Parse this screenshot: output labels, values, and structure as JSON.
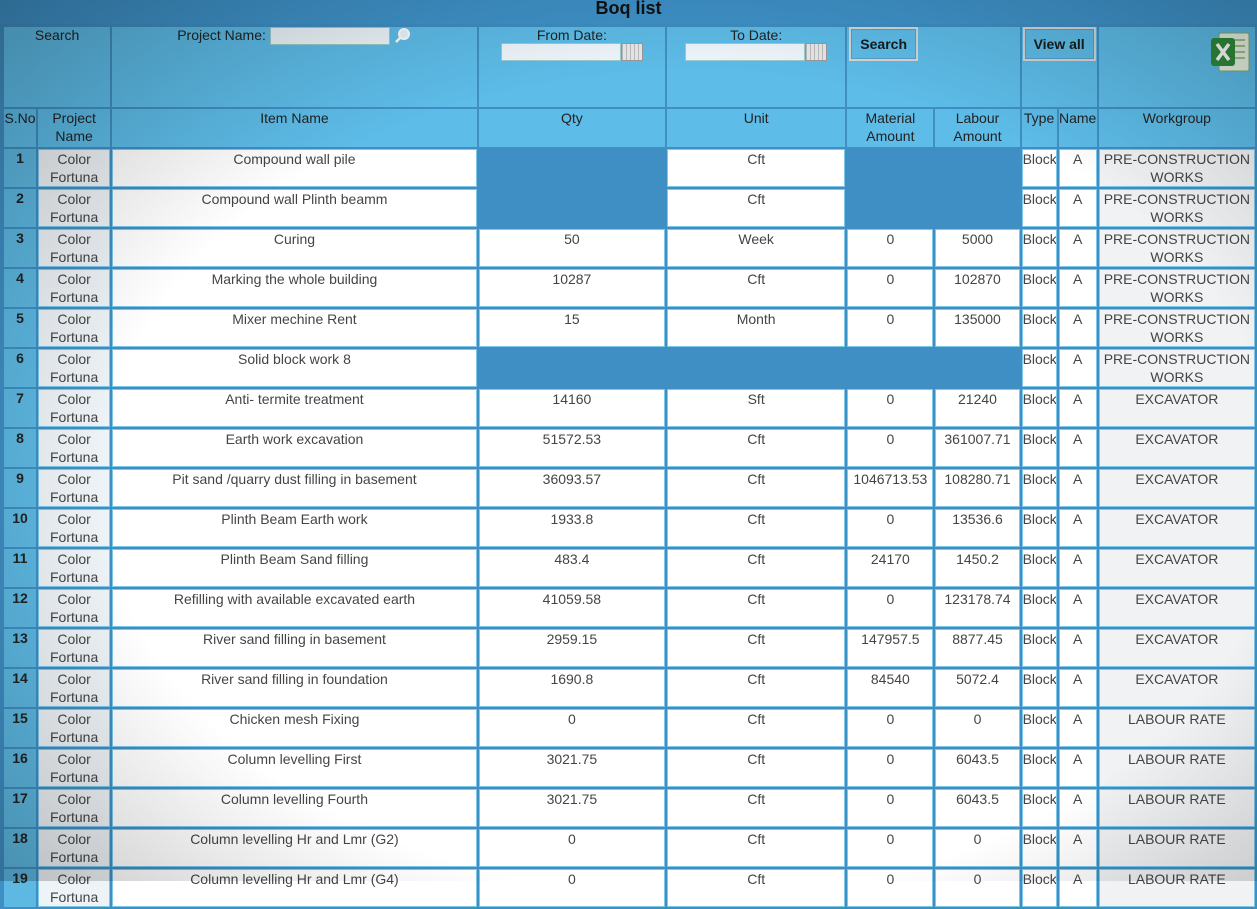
{
  "title": "Boq list",
  "filters": {
    "search_label": "Search",
    "project_name_label": "Project Name:",
    "project_name_value": "",
    "from_date_label": "From Date:",
    "from_date_value": "",
    "to_date_label": "To Date:",
    "to_date_value": "",
    "search_button": "Search",
    "view_all_button": "View all"
  },
  "columns": {
    "sno": "S.No",
    "project": "Project Name",
    "item": "Item Name",
    "qty": "Qty",
    "unit": "Unit",
    "material": "Material Amount",
    "labour": "Labour Amount",
    "type": "Type",
    "name": "Name",
    "workgroup": "Workgroup"
  },
  "rows": [
    {
      "sno": "1",
      "project": "Color Fortuna",
      "item": "Compound wall pile",
      "qty": "",
      "unit": "Cft",
      "material": "",
      "labour": "",
      "type": "Block",
      "name": "A",
      "workgroup": "PRE-CONSTRUCTION WORKS"
    },
    {
      "sno": "2",
      "project": "Color Fortuna",
      "item": "Compound wall Plinth beamm",
      "qty": "",
      "unit": "Cft",
      "material": "",
      "labour": "",
      "type": "Block",
      "name": "A",
      "workgroup": "PRE-CONSTRUCTION WORKS"
    },
    {
      "sno": "3",
      "project": "Color Fortuna",
      "item": "Curing",
      "qty": "50",
      "unit": "Week",
      "material": "0",
      "labour": "5000",
      "type": "Block",
      "name": "A",
      "workgroup": "PRE-CONSTRUCTION WORKS"
    },
    {
      "sno": "4",
      "project": "Color Fortuna",
      "item": "Marking the whole building",
      "qty": "10287",
      "unit": "Cft",
      "material": "0",
      "labour": "102870",
      "type": "Block",
      "name": "A",
      "workgroup": "PRE-CONSTRUCTION WORKS"
    },
    {
      "sno": "5",
      "project": "Color Fortuna",
      "item": "Mixer mechine Rent",
      "qty": "15",
      "unit": "Month",
      "material": "0",
      "labour": "135000",
      "type": "Block",
      "name": "A",
      "workgroup": "PRE-CONSTRUCTION WORKS"
    },
    {
      "sno": "6",
      "project": "Color Fortuna",
      "item": "Solid block work 8",
      "qty": "",
      "unit": "",
      "material": "",
      "labour": "",
      "type": "Block",
      "name": "A",
      "workgroup": "PRE-CONSTRUCTION WORKS"
    },
    {
      "sno": "7",
      "project": "Color Fortuna",
      "item": "Anti- termite treatment",
      "qty": "14160",
      "unit": "Sft",
      "material": "0",
      "labour": "21240",
      "type": "Block",
      "name": "A",
      "workgroup": "EXCAVATOR"
    },
    {
      "sno": "8",
      "project": "Color Fortuna",
      "item": "Earth work excavation",
      "qty": "51572.53",
      "unit": "Cft",
      "material": "0",
      "labour": "361007.71",
      "type": "Block",
      "name": "A",
      "workgroup": "EXCAVATOR"
    },
    {
      "sno": "9",
      "project": "Color Fortuna",
      "item": "Pit sand /quarry dust filling in basement",
      "qty": "36093.57",
      "unit": "Cft",
      "material": "1046713.53",
      "labour": "108280.71",
      "type": "Block",
      "name": "A",
      "workgroup": "EXCAVATOR"
    },
    {
      "sno": "10",
      "project": "Color Fortuna",
      "item": "Plinth Beam Earth work",
      "qty": "1933.8",
      "unit": "Cft",
      "material": "0",
      "labour": "13536.6",
      "type": "Block",
      "name": "A",
      "workgroup": "EXCAVATOR"
    },
    {
      "sno": "11",
      "project": "Color Fortuna",
      "item": "Plinth Beam Sand filling",
      "qty": "483.4",
      "unit": "Cft",
      "material": "24170",
      "labour": "1450.2",
      "type": "Block",
      "name": "A",
      "workgroup": "EXCAVATOR"
    },
    {
      "sno": "12",
      "project": "Color Fortuna",
      "item": "Refilling with available excavated earth",
      "qty": "41059.58",
      "unit": "Cft",
      "material": "0",
      "labour": "123178.74",
      "type": "Block",
      "name": "A",
      "workgroup": "EXCAVATOR"
    },
    {
      "sno": "13",
      "project": "Color Fortuna",
      "item": "River sand filling in basement",
      "qty": "2959.15",
      "unit": "Cft",
      "material": "147957.5",
      "labour": "8877.45",
      "type": "Block",
      "name": "A",
      "workgroup": "EXCAVATOR"
    },
    {
      "sno": "14",
      "project": "Color Fortuna",
      "item": "River sand filling in foundation",
      "qty": "1690.8",
      "unit": "Cft",
      "material": "84540",
      "labour": "5072.4",
      "type": "Block",
      "name": "A",
      "workgroup": "EXCAVATOR"
    },
    {
      "sno": "15",
      "project": "Color Fortuna",
      "item": "Chicken mesh Fixing",
      "qty": "0",
      "unit": "Cft",
      "material": "0",
      "labour": "0",
      "type": "Block",
      "name": "A",
      "workgroup": "LABOUR RATE"
    },
    {
      "sno": "16",
      "project": "Color Fortuna",
      "item": "Column levelling First",
      "qty": "3021.75",
      "unit": "Cft",
      "material": "0",
      "labour": "6043.5",
      "type": "Block",
      "name": "A",
      "workgroup": "LABOUR RATE"
    },
    {
      "sno": "17",
      "project": "Color Fortuna",
      "item": "Column levelling Fourth",
      "qty": "3021.75",
      "unit": "Cft",
      "material": "0",
      "labour": "6043.5",
      "type": "Block",
      "name": "A",
      "workgroup": "LABOUR RATE"
    },
    {
      "sno": "18",
      "project": "Color Fortuna",
      "item": "Column levelling Hr and Lmr (G2)",
      "qty": "0",
      "unit": "Cft",
      "material": "0",
      "labour": "0",
      "type": "Block",
      "name": "A",
      "workgroup": "LABOUR RATE"
    },
    {
      "sno": "19",
      "project": "Color Fortuna",
      "item": "Column levelling Hr and Lmr (G4)",
      "qty": "0",
      "unit": "Cft",
      "material": "0",
      "labour": "0",
      "type": "Block",
      "name": "A",
      "workgroup": "LABOUR RATE"
    }
  ],
  "colors": {
    "header_blue": "#5dbce8",
    "background_blue": "#3f8fc4",
    "excel_green": "#2e8b3a"
  },
  "icons": {
    "search": "search-icon",
    "calendar": "calendar-icon",
    "excel": "excel-export-icon"
  }
}
